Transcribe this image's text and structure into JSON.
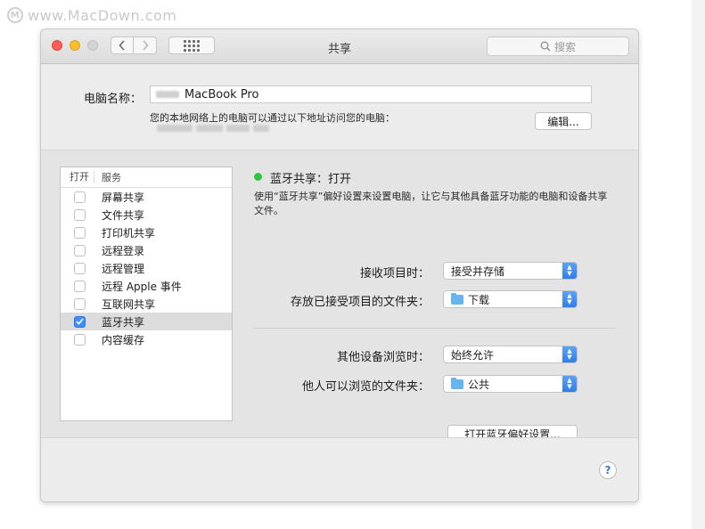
{
  "watermark": "www.MacDown.com",
  "window": {
    "title": "共享",
    "search_placeholder": "搜索"
  },
  "computer": {
    "label": "电脑名称：",
    "name": "MacBook Pro",
    "address_desc": "您的本地网络上的电脑可以通过以下地址访问您的电脑：",
    "edit_label": "编辑..."
  },
  "services": {
    "header_on": "打开",
    "header_service": "服务",
    "items": [
      {
        "label": "屏幕共享",
        "checked": false
      },
      {
        "label": "文件共享",
        "checked": false
      },
      {
        "label": "打印机共享",
        "checked": false
      },
      {
        "label": "远程登录",
        "checked": false
      },
      {
        "label": "远程管理",
        "checked": false
      },
      {
        "label": "远程 Apple 事件",
        "checked": false
      },
      {
        "label": "互联网共享",
        "checked": false
      },
      {
        "label": "蓝牙共享",
        "checked": true
      },
      {
        "label": "内容缓存",
        "checked": false
      }
    ]
  },
  "detail": {
    "status": "蓝牙共享：打开",
    "status_color": "#2bc840",
    "description": "使用“蓝牙共享”偏好设置来设置电脑，让它与其他具备蓝牙功能的电脑和设备共享文件。",
    "receive_label": "接收项目时：",
    "receive_value": "接受并存储",
    "store_label": "存放已接受项目的文件夹：",
    "store_value": "下载",
    "browse_label": "其他设备浏览时：",
    "browse_value": "始终允许",
    "browse_folder_label": "他人可以浏览的文件夹：",
    "browse_folder_value": "公共",
    "open_pref_label": "打开蓝牙偏好设置..."
  },
  "help_label": "?",
  "accent_color": "#3d8ef7"
}
